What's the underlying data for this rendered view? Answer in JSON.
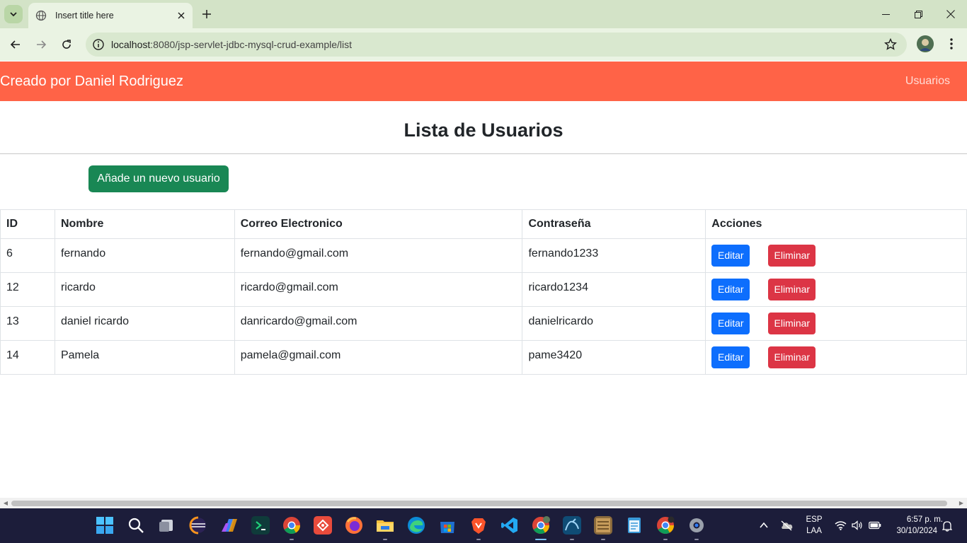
{
  "browser": {
    "tab_title": "Insert title here",
    "url_host": "localhost",
    "url_path": ":8080/jsp-servlet-jdbc-mysql-crud-example/list"
  },
  "navbar": {
    "brand": "Creado por Daniel Rodriguez",
    "link": "Usuarios",
    "color": "#ff6347"
  },
  "main": {
    "heading": "Lista de Usuarios",
    "add_button": "Añade un nuevo usuario"
  },
  "table": {
    "headers": [
      "ID",
      "Nombre",
      "Correo Electronico",
      "Contraseña",
      "Acciones"
    ],
    "rows": [
      {
        "id": "6",
        "name": "fernando",
        "email": "fernando@gmail.com",
        "password": "fernando1233"
      },
      {
        "id": "12",
        "name": "ricardo",
        "email": "ricardo@gmail.com",
        "password": "ricardo1234"
      },
      {
        "id": "13",
        "name": "daniel ricardo",
        "email": "danricardo@gmail.com",
        "password": "danielricardo"
      },
      {
        "id": "14",
        "name": "Pamela",
        "email": "pamela@gmail.com",
        "password": "pame3420"
      }
    ],
    "edit_label": "Editar",
    "delete_label": "Eliminar"
  },
  "taskbar": {
    "language": "ESP",
    "layout": "LAA",
    "time": "6:57 p. m.",
    "date": "30/10/2024",
    "apps": [
      "start-icon",
      "search-icon",
      "task-view-icon",
      "eclipse-icon",
      "copilot-icon",
      "terminal-icon",
      "chrome-icon",
      "git-icon",
      "firefox-icon",
      "file-explorer-icon",
      "edge-icon",
      "store-icon",
      "brave-icon",
      "vscode-icon",
      "chrome-profile-icon",
      "mysql-workbench-icon",
      "jar-tool-icon",
      "notepad-icon",
      "chrome-alt-icon",
      "settings-icon"
    ]
  }
}
